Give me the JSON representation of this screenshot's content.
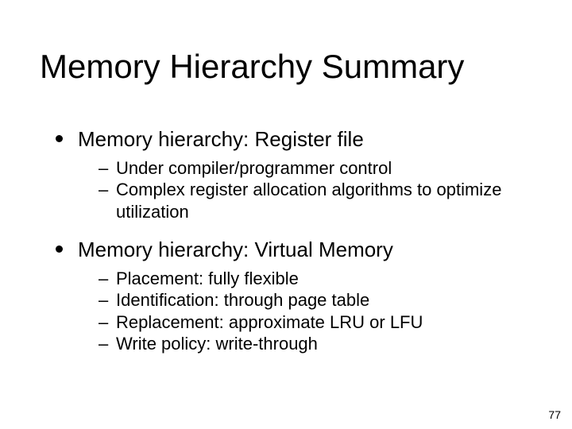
{
  "slide": {
    "title": "Memory Hierarchy Summary",
    "bullets": [
      {
        "text": "Memory hierarchy: Register file",
        "sub": [
          "Under compiler/programmer control",
          "Complex register allocation algorithms to optimize utilization"
        ]
      },
      {
        "text": "Memory hierarchy: Virtual Memory",
        "sub": [
          "Placement: fully flexible",
          "Identification: through page table",
          "Replacement: approximate LRU or LFU",
          "Write policy: write-through"
        ]
      }
    ],
    "page_number": "77"
  }
}
